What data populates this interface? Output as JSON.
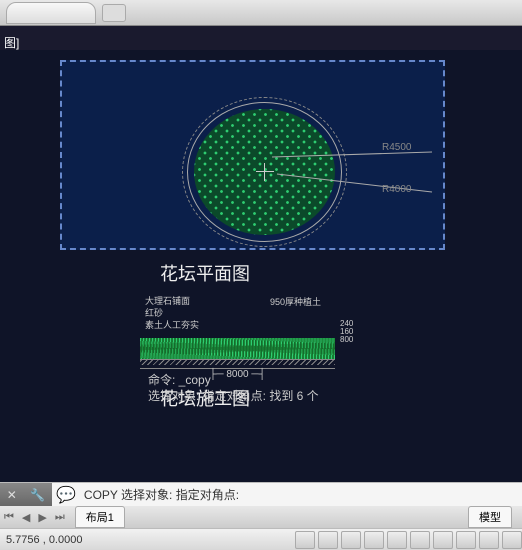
{
  "titleFragment": "图]",
  "drawing": {
    "planLabel": "花坛平面图",
    "sectionLabel": "花坛施工图",
    "dimR1": "R4500",
    "dimR2": "R4000",
    "dim8000": "8000",
    "note1": "大理石铺面",
    "note2": "红砂",
    "note3": "素土人工夯实",
    "note4": "950厚种植土",
    "stack1": "240",
    "stack2": "160",
    "stack3": "800"
  },
  "commandHistory": {
    "line1": "命令: _copy",
    "line2": "选择对象: 指定对角点: 找到 6 个"
  },
  "commandBar": {
    "prompt": "COPY 选择对象: 指定对角点:",
    "value": ""
  },
  "layoutTabs": {
    "layout1": "布局1",
    "model": "模型"
  },
  "status": {
    "coords": "5.7756 , 0.0000"
  }
}
